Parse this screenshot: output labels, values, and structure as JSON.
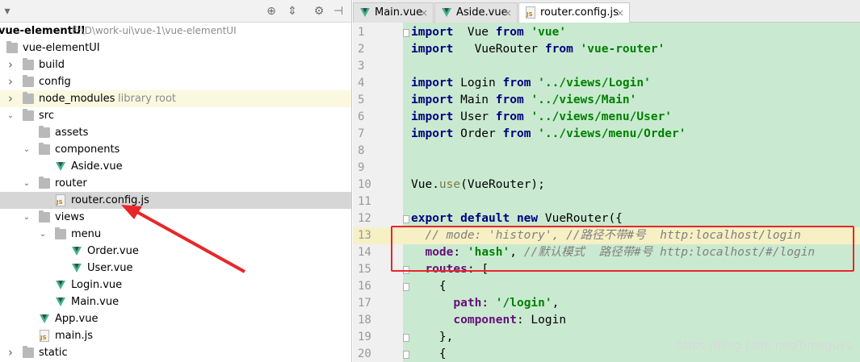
{
  "project_pane": {
    "title": "vue-elementUI",
    "path": "E:\\D\\work-ui\\vue-1\\vue-elementUI",
    "library_root_label": "library root",
    "tree": [
      {
        "label": "vue-elementUI",
        "depth": 0,
        "arrow": "down",
        "icon": "folder"
      },
      {
        "label": "build",
        "depth": 1,
        "arrow": "right",
        "icon": "folder"
      },
      {
        "label": "config",
        "depth": 1,
        "arrow": "right",
        "icon": "folder"
      },
      {
        "label": "node_modules",
        "depth": 1,
        "arrow": "right",
        "icon": "folder",
        "library": true
      },
      {
        "label": "src",
        "depth": 1,
        "arrow": "down",
        "icon": "folder"
      },
      {
        "label": "assets",
        "depth": 2,
        "arrow": "",
        "icon": "folder"
      },
      {
        "label": "components",
        "depth": 2,
        "arrow": "down",
        "icon": "folder"
      },
      {
        "label": "Aside.vue",
        "depth": 3,
        "arrow": "",
        "icon": "vue"
      },
      {
        "label": "router",
        "depth": 2,
        "arrow": "down",
        "icon": "folder"
      },
      {
        "label": "router.config.js",
        "depth": 3,
        "arrow": "",
        "icon": "js",
        "selected": true
      },
      {
        "label": "views",
        "depth": 2,
        "arrow": "down",
        "icon": "folder"
      },
      {
        "label": "menu",
        "depth": 3,
        "arrow": "down",
        "icon": "folder"
      },
      {
        "label": "Order.vue",
        "depth": 4,
        "arrow": "",
        "icon": "vue"
      },
      {
        "label": "User.vue",
        "depth": 4,
        "arrow": "",
        "icon": "vue"
      },
      {
        "label": "Login.vue",
        "depth": 3,
        "arrow": "",
        "icon": "vue"
      },
      {
        "label": "Main.vue",
        "depth": 3,
        "arrow": "",
        "icon": "vue"
      },
      {
        "label": "App.vue",
        "depth": 2,
        "arrow": "",
        "icon": "vue"
      },
      {
        "label": "main.js",
        "depth": 2,
        "arrow": "",
        "icon": "js"
      },
      {
        "label": "static",
        "depth": 1,
        "arrow": "right",
        "icon": "folder"
      }
    ]
  },
  "editor": {
    "tabs": [
      {
        "label": "Main.vue",
        "icon": "vue",
        "active": false
      },
      {
        "label": "Aside.vue",
        "icon": "vue",
        "active": false
      },
      {
        "label": "router.config.js",
        "icon": "js",
        "active": true
      }
    ],
    "close_glyph": "×",
    "current_line": 13,
    "lines": [
      {
        "n": "1",
        "tokens": [
          [
            "kw",
            "import"
          ],
          [
            "",
            "  Vue "
          ],
          [
            "kw",
            "from"
          ],
          [
            "",
            " "
          ],
          [
            "str",
            "'vue'"
          ]
        ]
      },
      {
        "n": "2",
        "tokens": [
          [
            "kw",
            "import"
          ],
          [
            "",
            "   VueRouter "
          ],
          [
            "kw",
            "from"
          ],
          [
            "",
            " "
          ],
          [
            "str",
            "'vue-router'"
          ]
        ]
      },
      {
        "n": "3",
        "tokens": []
      },
      {
        "n": "4",
        "tokens": [
          [
            "kw",
            "import"
          ],
          [
            "",
            " Login "
          ],
          [
            "kw",
            "from"
          ],
          [
            "",
            " "
          ],
          [
            "str",
            "'../views/Login'"
          ]
        ]
      },
      {
        "n": "5",
        "tokens": [
          [
            "kw",
            "import"
          ],
          [
            "",
            " Main "
          ],
          [
            "kw",
            "from"
          ],
          [
            "",
            " "
          ],
          [
            "str",
            "'../views/Main'"
          ]
        ]
      },
      {
        "n": "6",
        "tokens": [
          [
            "kw",
            "import"
          ],
          [
            "",
            " User "
          ],
          [
            "kw",
            "from"
          ],
          [
            "",
            " "
          ],
          [
            "str",
            "'../views/menu/User'"
          ]
        ]
      },
      {
        "n": "7",
        "tokens": [
          [
            "kw",
            "import"
          ],
          [
            "",
            " Order "
          ],
          [
            "kw",
            "from"
          ],
          [
            "",
            " "
          ],
          [
            "str",
            "'../views/menu/Order'"
          ]
        ]
      },
      {
        "n": "8",
        "tokens": []
      },
      {
        "n": "9",
        "tokens": []
      },
      {
        "n": "10",
        "tokens": [
          [
            "",
            "Vue."
          ],
          [
            "fn",
            "use"
          ],
          [
            "",
            "(VueRouter);"
          ]
        ]
      },
      {
        "n": "11",
        "tokens": []
      },
      {
        "n": "12",
        "tokens": [
          [
            "kw",
            "export default new"
          ],
          [
            "",
            " VueRouter({"
          ]
        ]
      },
      {
        "n": "13",
        "tokens": [
          [
            "",
            "  "
          ],
          [
            "cmt",
            "// mode: 'history', //路径不带#号  http:localhost/login"
          ]
        ]
      },
      {
        "n": "14",
        "tokens": [
          [
            "",
            "  "
          ],
          [
            "prop",
            "mode"
          ],
          [
            "",
            ": "
          ],
          [
            "str",
            "'hash'"
          ],
          [
            "",
            ", "
          ],
          [
            "cmt",
            "//默认模式  路径带#号 http:localhost/#/login"
          ]
        ]
      },
      {
        "n": "15",
        "tokens": [
          [
            "",
            "  "
          ],
          [
            "prop",
            "routes"
          ],
          [
            "",
            ": ["
          ]
        ]
      },
      {
        "n": "16",
        "tokens": [
          [
            "",
            "    {"
          ]
        ]
      },
      {
        "n": "17",
        "tokens": [
          [
            "",
            "      "
          ],
          [
            "prop",
            "path"
          ],
          [
            "",
            ": "
          ],
          [
            "str",
            "'/login'"
          ],
          [
            "",
            ","
          ]
        ]
      },
      {
        "n": "18",
        "tokens": [
          [
            "",
            "      "
          ],
          [
            "prop",
            "component"
          ],
          [
            "",
            ": Login"
          ]
        ]
      },
      {
        "n": "19",
        "tokens": [
          [
            "",
            "    },"
          ]
        ]
      },
      {
        "n": "20",
        "tokens": [
          [
            "",
            "    {"
          ]
        ]
      }
    ]
  },
  "watermark": "https://blog.csdn.net/Timeguys",
  "colors": {
    "code_bg": "#c9ead0",
    "annotation_red": "#e8262a",
    "keyword": "#000080",
    "string": "#008000",
    "comment": "#808080"
  }
}
